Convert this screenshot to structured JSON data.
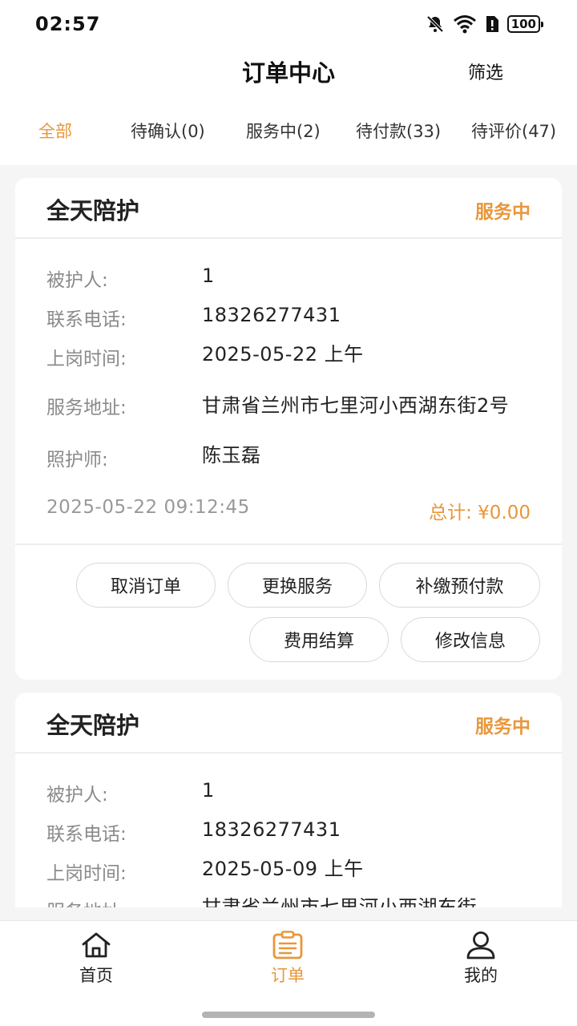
{
  "status_bar": {
    "time": "02:57",
    "battery": "100"
  },
  "header": {
    "title": "订单中心",
    "filter_label": "筛选"
  },
  "tabs": [
    {
      "label": "全部",
      "active": true
    },
    {
      "label": "待确认(0)",
      "active": false
    },
    {
      "label": "服务中(2)",
      "active": false
    },
    {
      "label": "待付款(33)",
      "active": false
    },
    {
      "label": "待评价(47)",
      "active": false
    }
  ],
  "orders": [
    {
      "title": "全天陪护",
      "status": "服务中",
      "fields": [
        {
          "label": "被护人:",
          "value": "1"
        },
        {
          "label": "联系电话:",
          "value": "18326277431"
        },
        {
          "label": "上岗时间:",
          "value": "2025-05-22 上午"
        },
        {
          "label": "服务地址:",
          "value": "甘肃省兰州市七里河小西湖东街2号"
        },
        {
          "label": "照护师:",
          "value": "陈玉磊"
        }
      ],
      "created_time": "2025-05-22 09:12:45",
      "total": "总计: ¥0.00",
      "actions": [
        "取消订单",
        "更换服务",
        "补缴预付款",
        "费用结算",
        "修改信息"
      ]
    },
    {
      "title": "全天陪护",
      "status": "服务中",
      "fields": [
        {
          "label": "被护人:",
          "value": "1"
        },
        {
          "label": "联系电话:",
          "value": "18326277431"
        },
        {
          "label": "上岗时间:",
          "value": "2025-05-09 上午"
        },
        {
          "label": "服务地址:",
          "value": "甘肃省兰州市七里河小西湖东街"
        }
      ]
    }
  ],
  "bottom_nav": [
    {
      "label": "首页",
      "icon": "home-icon",
      "active": false
    },
    {
      "label": "订单",
      "icon": "clipboard-icon",
      "active": true
    },
    {
      "label": "我的",
      "icon": "user-icon",
      "active": false
    }
  ],
  "colors": {
    "accent": "#e8973b",
    "background": "#f5f5f5"
  }
}
